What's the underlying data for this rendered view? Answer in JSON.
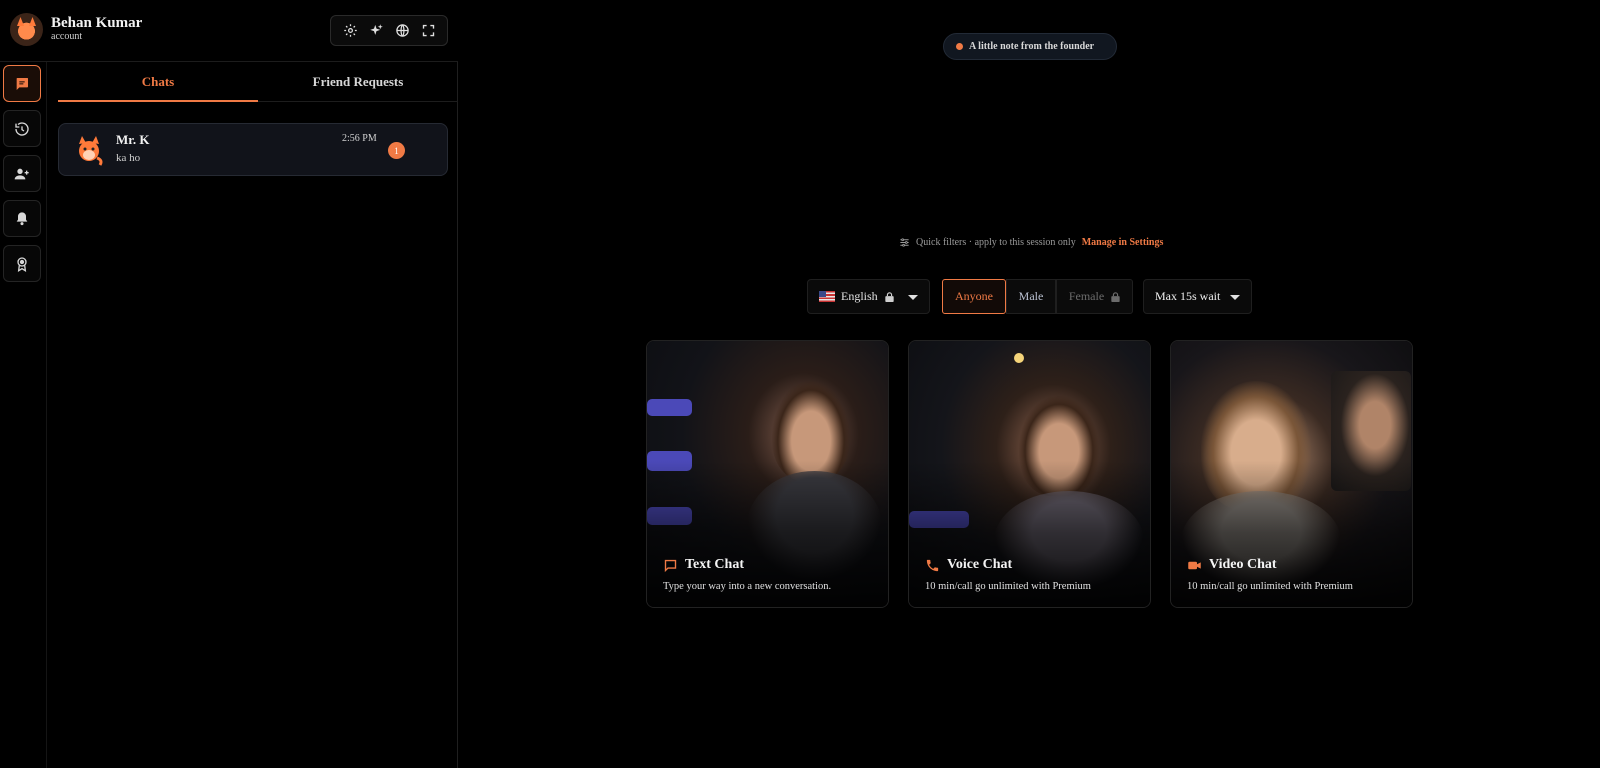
{
  "profile": {
    "name": "Behan Kumar",
    "subtitle": "account",
    "avatar_icon": "fox-avatar-icon"
  },
  "toolbar": {
    "icons": [
      "gear-icon",
      "sparkle-icon",
      "globe-icon",
      "fullscreen-icon"
    ]
  },
  "rail": {
    "items": [
      "chat-icon",
      "history-icon",
      "add-user-icon",
      "bell-icon",
      "badge-icon"
    ],
    "active": "chat-icon"
  },
  "tabs": [
    {
      "label": "Chats",
      "active": true
    },
    {
      "label": "Friend Requests",
      "active": false
    }
  ],
  "chats": [
    {
      "name": "Mr. K",
      "preview": "ka ho",
      "time": "2:56 PM",
      "unread": "1"
    }
  ],
  "founder_note": "A little note from the founder",
  "quick_filters": {
    "text": "Quick filters · apply to this session only",
    "link": "Manage in Settings"
  },
  "filters": {
    "language": "English",
    "gender_options": [
      "Anyone",
      "Male",
      "Female"
    ],
    "gender_selected": "Anyone",
    "wait": "Max 15s wait"
  },
  "cards": [
    {
      "title": "Text Chat",
      "description": "Type your way into a new conversation.",
      "icon": "chat-bubble-icon"
    },
    {
      "title": "Voice Chat",
      "description": "10 min/call go unlimited with Premium",
      "icon": "phone-icon"
    },
    {
      "title": "Video Chat",
      "description": "10 min/call go unlimited with Premium",
      "icon": "video-camera-icon"
    }
  ],
  "colors": {
    "accent": "#f07a45",
    "background": "#000000",
    "card_border": "#222222"
  }
}
